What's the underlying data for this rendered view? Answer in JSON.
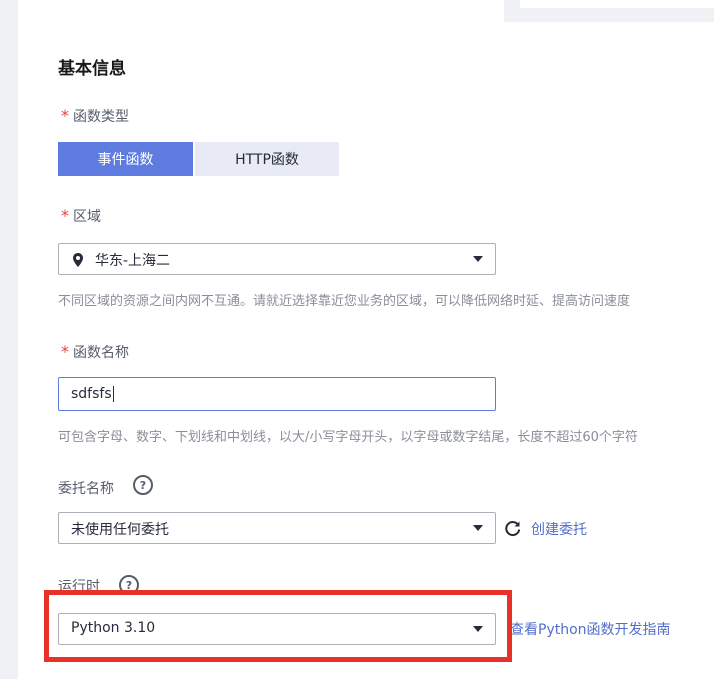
{
  "section": {
    "title": "基本信息"
  },
  "function_type": {
    "required_mark": "*",
    "label": "函数类型",
    "options": [
      "事件函数",
      "HTTP函数"
    ],
    "selected": "事件函数"
  },
  "region": {
    "required_mark": "*",
    "label": "区域",
    "value": "华东-上海二",
    "hint": "不同区域的资源之间内网不互通。请就近选择靠近您业务的区域，可以降低网络时延、提高访问速度"
  },
  "function_name": {
    "required_mark": "*",
    "label": "函数名称",
    "value": "sdfsfs",
    "hint": "可包含字母、数字、下划线和中划线，以大/小写字母开头，以字母或数字结尾，长度不超过60个字符"
  },
  "agency": {
    "label": "委托名称",
    "help": "?",
    "value": "未使用任何委托",
    "create_link": "创建委托"
  },
  "runtime": {
    "label": "运行时",
    "help": "?",
    "value": "Python 3.10",
    "guide_link": "查看Python函数开发指南"
  },
  "colors": {
    "accent": "#5e7ce0",
    "required": "#e2463f",
    "highlight": "#e9302a",
    "link": "#526ecc"
  }
}
